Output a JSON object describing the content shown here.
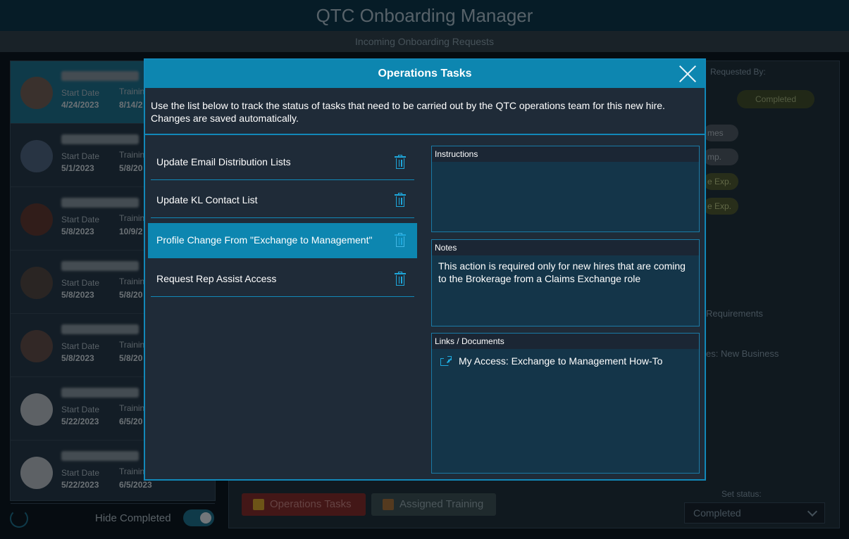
{
  "app": {
    "title": "QTC Onboarding Manager",
    "subtitle": "Incoming Onboarding Requests"
  },
  "requests": [
    {
      "start_label": "Start Date",
      "start_date": "4/24/2023",
      "training_label": "Training",
      "training_date": "8/14/2"
    },
    {
      "start_label": "Start Date",
      "start_date": "5/1/2023",
      "training_label": "Training",
      "training_date": "5/8/20"
    },
    {
      "start_label": "Start Date",
      "start_date": "5/8/2023",
      "training_label": "Training",
      "training_date": "10/9/2"
    },
    {
      "start_label": "Start Date",
      "start_date": "5/8/2023",
      "training_label": "Training",
      "training_date": "5/8/20"
    },
    {
      "start_label": "Start Date",
      "start_date": "5/8/2023",
      "training_label": "Training",
      "training_date": "5/8/20"
    },
    {
      "start_label": "Start Date",
      "start_date": "5/22/2023",
      "training_label": "Training",
      "training_date": "6/5/20"
    },
    {
      "start_label": "Start Date",
      "start_date": "5/22/2023",
      "training_label": "Training",
      "training_date": "6/5/2023"
    }
  ],
  "sidebar_footer": {
    "hide_completed_label": "Hide Completed"
  },
  "detail": {
    "requested_by_label": "Requested By:",
    "completed_pill": "Completed",
    "pills": [
      "mes",
      "mp.",
      "e Exp.",
      "e Exp."
    ],
    "requirements_text": "Requirements",
    "new_business_text": "es: New Business",
    "operations_tasks_button": "Operations Tasks",
    "assigned_training_button": "Assigned Training",
    "set_status_label": "Set status:",
    "status_value": "Completed"
  },
  "modal": {
    "title": "Operations Tasks",
    "description": "Use the list below to track the status of tasks that need to be carried out by the QTC operations team for this new hire. Changes are saved automatically.",
    "tasks": [
      {
        "label": "Update Email Distribution Lists"
      },
      {
        "label": "Update KL Contact List"
      },
      {
        "label": "Profile Change From \"Exchange to Management\""
      },
      {
        "label": "Request Rep Assist Access"
      }
    ],
    "instructions_header": "Instructions",
    "instructions_text": "",
    "notes_header": "Notes",
    "notes_text": "This action is required only for new hires that are coming to the Brokerage from a Claims Exchange role",
    "links_header": "Links / Documents",
    "links": [
      {
        "label": "My Access: Exchange to Management How-To"
      }
    ]
  },
  "colors": {
    "accent": "#0d86b0",
    "modal_bg": "#1f2b38",
    "panel_bg": "#143549"
  }
}
